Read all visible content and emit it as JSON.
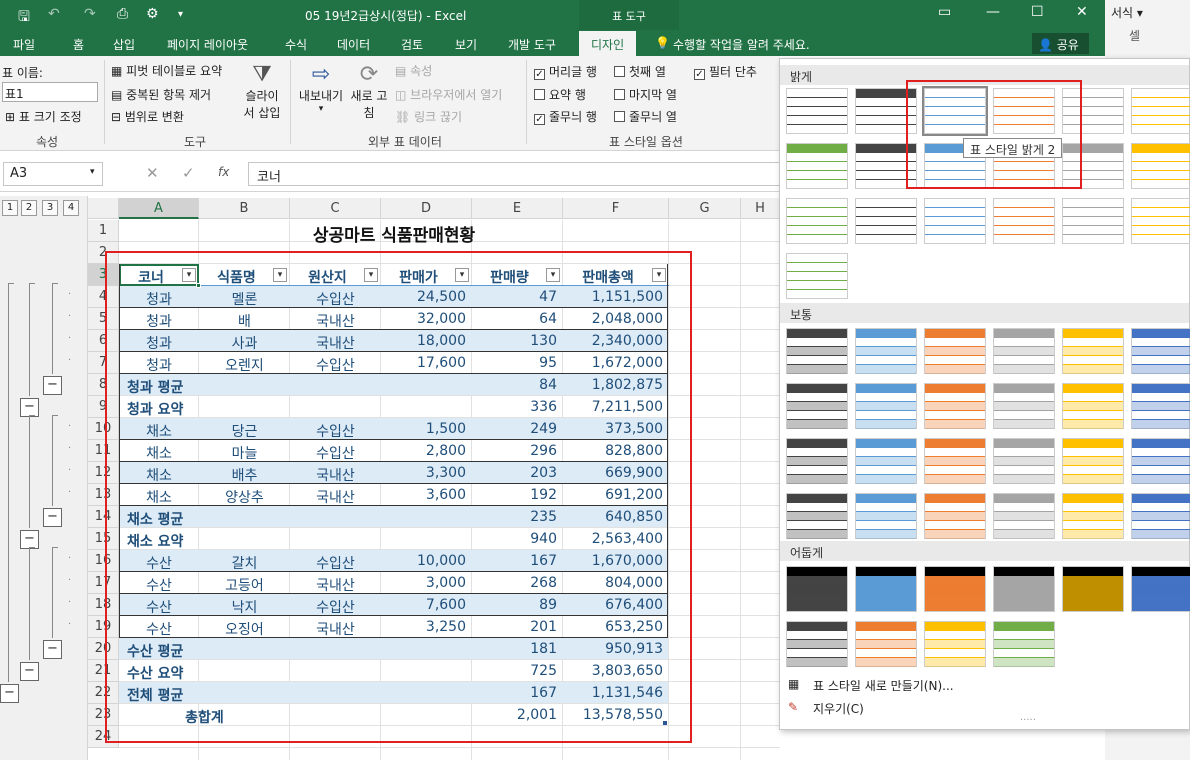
{
  "app": {
    "doc_title": "05 19년2급상시(정답) - Excel",
    "tools_context": "표 도구"
  },
  "tabs": [
    "파일",
    "홈",
    "삽입",
    "페이지 레이아웃",
    "수식",
    "데이터",
    "검토",
    "보기",
    "개발 도구",
    "디자인"
  ],
  "tell_me": "수행할 작업을 알려 주세요.",
  "share": "공유",
  "ribbon": {
    "table_name_label": "표 이름:",
    "table_name_value": "표1",
    "resize": "표 크기 조정",
    "grp_props": "속성",
    "pivot": "피벗 테이블로 요약",
    "remove_dup": "중복된 항목 제거",
    "convert_range": "범위로 변환",
    "slicer_line1": "슬라이",
    "slicer_line2": "서 삽입",
    "grp_tools": "도구",
    "export": "내보내기",
    "refresh_line1": "새로 고",
    "refresh_line2": "침",
    "properties": "속성",
    "open_browser": "브라우저에서 열기",
    "unlink": "링크 끊기",
    "grp_external": "외부 표 데이터",
    "opt_header": "머리글 행",
    "opt_total": "요약 행",
    "opt_banded_rows": "줄무늬 행",
    "opt_first_col": "첫째 열",
    "opt_last_col": "마지막 열",
    "opt_banded_cols": "줄무늬 열",
    "opt_filter": "필터 단추",
    "grp_options": "표 스타일 옵션",
    "right_format": "서식",
    "right_cell": "셀"
  },
  "formula_bar": {
    "name_box": "A3",
    "fx": "fx",
    "value": "코너"
  },
  "outline_levels": [
    "1",
    "2",
    "3",
    "4"
  ],
  "columns": [
    "A",
    "B",
    "C",
    "D",
    "E",
    "F",
    "G",
    "H"
  ],
  "rows": [
    "1",
    "2",
    "3",
    "4",
    "5",
    "6",
    "7",
    "8",
    "9",
    "10",
    "11",
    "12",
    "13",
    "14",
    "15",
    "16",
    "17",
    "18",
    "19",
    "20",
    "21",
    "22",
    "23",
    "24"
  ],
  "sheet": {
    "title": "상공마트 식품판매현황",
    "headers": [
      "코너",
      "식품명",
      "원산지",
      "판매가",
      "판매량",
      "판매총액"
    ],
    "data": [
      [
        "청과",
        "멜론",
        "수입산",
        "24,500",
        "47",
        "1,151,500"
      ],
      [
        "청과",
        "배",
        "국내산",
        "32,000",
        "64",
        "2,048,000"
      ],
      [
        "청과",
        "사과",
        "국내산",
        "18,000",
        "130",
        "2,340,000"
      ],
      [
        "청과",
        "오렌지",
        "수입산",
        "17,600",
        "95",
        "1,672,000"
      ],
      [
        "청과 평균",
        "",
        "",
        "",
        "84",
        "1,802,875"
      ],
      [
        "청과 요약",
        "",
        "",
        "",
        "336",
        "7,211,500"
      ],
      [
        "채소",
        "당근",
        "수입산",
        "1,500",
        "249",
        "373,500"
      ],
      [
        "채소",
        "마늘",
        "수입산",
        "2,800",
        "296",
        "828,800"
      ],
      [
        "채소",
        "배추",
        "국내산",
        "3,300",
        "203",
        "669,900"
      ],
      [
        "채소",
        "양상추",
        "국내산",
        "3,600",
        "192",
        "691,200"
      ],
      [
        "채소 평균",
        "",
        "",
        "",
        "235",
        "640,850"
      ],
      [
        "채소 요약",
        "",
        "",
        "",
        "940",
        "2,563,400"
      ],
      [
        "수산",
        "갈치",
        "수입산",
        "10,000",
        "167",
        "1,670,000"
      ],
      [
        "수산",
        "고등어",
        "국내산",
        "3,000",
        "268",
        "804,000"
      ],
      [
        "수산",
        "낙지",
        "수입산",
        "7,600",
        "89",
        "676,400"
      ],
      [
        "수산",
        "오징어",
        "국내산",
        "3,250",
        "201",
        "653,250"
      ],
      [
        "수산 평균",
        "",
        "",
        "",
        "181",
        "950,913"
      ],
      [
        "수산 요약",
        "",
        "",
        "",
        "725",
        "3,803,650"
      ],
      [
        "전체 평균",
        "",
        "",
        "",
        "167",
        "1,131,546"
      ],
      [
        "총합계",
        "",
        "",
        "",
        "2,001",
        "13,578,550"
      ]
    ]
  },
  "gallery": {
    "sec_light": "밝게",
    "sec_medium": "보통",
    "sec_dark": "어둡게",
    "tooltip": "표 스타일 밝게 2",
    "new_style": "표 스타일 새로 만들기(N)...",
    "clear": "지우기(C)",
    "palette": [
      "#444444",
      "#5b9bd5",
      "#ed7d31",
      "#a5a5a5",
      "#ffc000",
      "#4472c4",
      "#70ad47"
    ]
  }
}
